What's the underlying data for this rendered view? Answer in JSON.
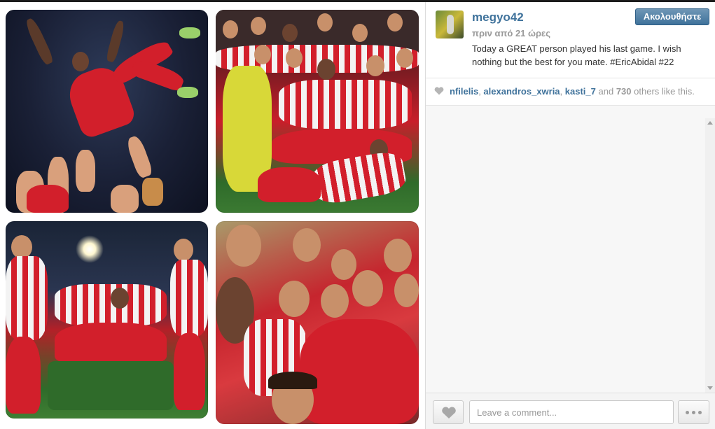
{
  "post": {
    "username": "megyo42",
    "timestamp": "πριν από 21 ώρες",
    "follow_label": "Ακολουθήστε",
    "caption": "Today a GREAT person played his last game. I wish nothing but the best for you mate. #EricAbidal #22"
  },
  "likes": {
    "likers": [
      "nfilelis",
      "alexandros_xwria",
      "kasti_7"
    ],
    "connector": "and",
    "others_count": "730",
    "others_suffix": "others like this."
  },
  "comment_box": {
    "placeholder": "Leave a comment..."
  },
  "icons": {
    "like": "heart-icon",
    "more": "ellipsis-icon",
    "scroll_up": "triangle-up-icon",
    "scroll_down": "triangle-down-icon"
  },
  "colors": {
    "link_blue": "#3f729b",
    "muted_gray": "#999999",
    "team_red": "#d21f2b"
  }
}
